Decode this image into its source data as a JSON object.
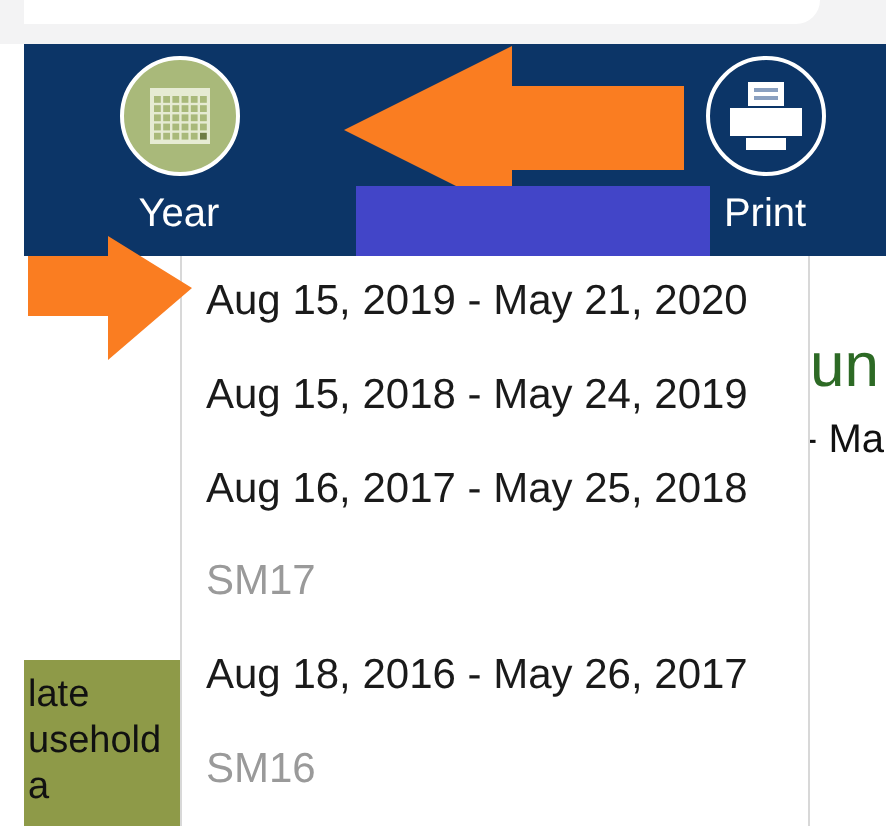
{
  "toolbar": {
    "items": [
      {
        "kind": "calendar",
        "label": "Year",
        "selected": true
      },
      {
        "kind": "printer",
        "label": "Print",
        "selected": false
      }
    ]
  },
  "year_menu": {
    "items": [
      {
        "label": "Aug 15, 2019 - May 21, 2020",
        "disabled": false
      },
      {
        "label": "Aug 15, 2018 - May 24, 2019",
        "disabled": false
      },
      {
        "label": "Aug 16, 2017 - May 25, 2018",
        "disabled": false
      },
      {
        "label": "SM17",
        "disabled": true
      },
      {
        "label": "Aug 18, 2016 - May 26, 2017",
        "disabled": false
      },
      {
        "label": "SM16",
        "disabled": true
      }
    ]
  },
  "background": {
    "heading": "un",
    "subheading": "- Ma",
    "side_panel": [
      "late",
      "usehold",
      "a"
    ]
  },
  "annotations": [
    {
      "kind": "arrow_left"
    },
    {
      "kind": "redaction"
    },
    {
      "kind": "arrow_right"
    }
  ]
}
